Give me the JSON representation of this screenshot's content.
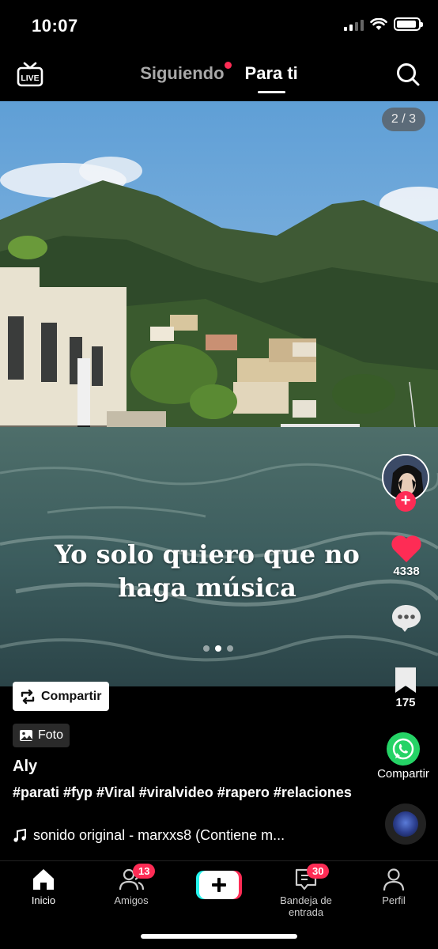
{
  "status_bar": {
    "time": "10:07"
  },
  "top_nav": {
    "live_icon": "live-tv-icon",
    "tabs": [
      {
        "label": "Siguiendo",
        "has_notification_dot": true,
        "active": false
      },
      {
        "label": "Para ti",
        "active": true
      }
    ],
    "search_icon": "search-icon"
  },
  "post": {
    "page_counter": "2 / 3",
    "caption": "Yo solo quiero que no haga música",
    "carousel_current": 2,
    "carousel_total": 3,
    "share_chip_label": "Compartir",
    "type_chip_label": "Foto",
    "author": "Aly",
    "description": "#parati #fyp #Viral #viralvideo #rapero #relaciones",
    "sound": "sonido original - marxxs8 (Contiene m..."
  },
  "actions": {
    "likes": "4338",
    "bookmarks": "175",
    "share_label": "Compartir"
  },
  "bottom_nav": {
    "items": [
      {
        "label": "Inicio",
        "icon": "home-icon",
        "active": true
      },
      {
        "label": "Amigos",
        "icon": "friends-icon",
        "badge": "13"
      },
      {
        "label": "",
        "icon": "create-plus-icon"
      },
      {
        "label": "Bandeja de entrada",
        "icon": "inbox-icon",
        "badge": "30"
      },
      {
        "label": "Perfil",
        "icon": "profile-icon"
      }
    ]
  },
  "colors": {
    "accent": "#fe2c55",
    "whatsapp": "#25d366",
    "background": "#000000"
  }
}
